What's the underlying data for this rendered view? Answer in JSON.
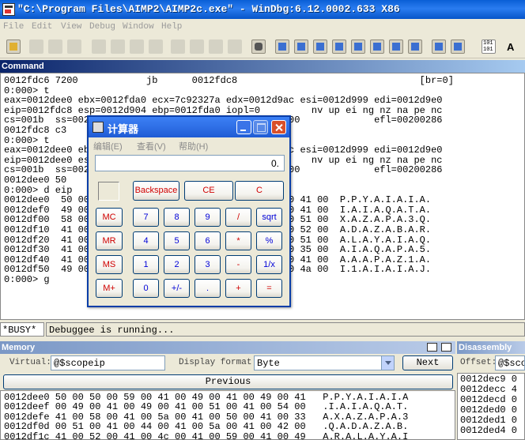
{
  "window": {
    "title": "\"C:\\Program Files\\AIMP2\\AIMP2c.exe\" - WinDbg:6.12.0002.633 X86"
  },
  "menu": [
    "File",
    "Edit",
    "View",
    "Debug",
    "Window",
    "Help"
  ],
  "toolbar": {
    "font_label": "A",
    "hex_label": "101\n101"
  },
  "command": {
    "title": "Command",
    "lines": [
      "0012fdc6 7200            jb      0012fdc8                                [br=0]",
      "0:000> t",
      "eax=0012dee0 ebx=0012fda0 ecx=7c92327a edx=0012d9ac esi=0012d999 edi=0012d9e0",
      "eip=0012fdc8 esp=0012d904 ebp=0012fda0 iopl=0         nv up ei ng nz na pe nc",
      "cs=001b  ss=0023  ds=0023  es=0023  fs=003b  gs=0000             efl=00200286",
      "0012fdc8 c3",
      "0:000> t",
      "eax=0012dee0 ebx=0012fda0 ecx=7c92327a edx=0012d9ac esi=0012d999 edi=0012d9e0",
      "eip=0012dee0 esp=0012d908 ebp=0012fda0 iopl=0         nv up ei ng nz na pe nc",
      "cs=001b  ss=0023  ds=0023  es=0023  fs=003b  gs=0000             efl=00200286",
      "0012dee0 50",
      "0:000> d eip",
      "0012dee0  50 00 50 00 59 00 41 00-49 00 41 00 49 00 41 00  P.P.Y.A.I.A.I.A.",
      "0012def0  49 00 51 00 41 00 49 00-41 00 51 00 54 00 41 00  I.A.I.A.Q.A.T.A.",
      "0012df00  58 00 41 00 5a 00 41 00-50 00 41 00 33 00 51 00  X.A.Z.A.P.A.3.Q.",
      "0012df10  41 00 44 00 41 00 5a 00-41 00 42 00 41 00 52 00  A.D.A.Z.A.B.A.R.",
      "0012df20  41 00 4c 00 41 00 59 00-41 00 49 00 41 00 51 00  A.L.A.Y.A.I.A.Q.",
      "0012df30  41 00 49 00 41 00 51 00-41 00 50 00 41 00 35 00  A.I.A.Q.A.P.A.5.",
      "0012df40  41 00 41 00 41 00 50 00-41 00 5a 00 31 00 41 00  A.A.A.P.A.Z.1.A.",
      "0012df50  49 00 31 00 41 00 49 00-41 00 49 00 41 00 4a 00  I.1.A.I.A.I.A.J.",
      "0:000> g"
    ],
    "busy_label": "*BUSY*",
    "status_text": "Debuggee is running..."
  },
  "calculator": {
    "title": "计算器",
    "menu": [
      "编辑(E)",
      "查看(V)",
      "帮助(H)"
    ],
    "display": "0.",
    "buttons": {
      "backspace": "Backspace",
      "ce": "CE",
      "c": "C",
      "mc": "MC",
      "mr": "MR",
      "ms": "MS",
      "mplus": "M+",
      "n7": "7",
      "n8": "8",
      "n9": "9",
      "div": "/",
      "sqrt": "sqrt",
      "n4": "4",
      "n5": "5",
      "n6": "6",
      "mul": "*",
      "pct": "%",
      "n1": "1",
      "n2": "2",
      "n3": "3",
      "sub": "-",
      "recip": "1/x",
      "n0": "0",
      "sign": "+/-",
      "dot": ".",
      "add": "+",
      "eq": "="
    }
  },
  "memory": {
    "title": "Memory",
    "virtual_label": "Virtual:",
    "virtual_value": "@$scopeip",
    "format_label": "Display format:",
    "format_value": "Byte",
    "next_label": "Next",
    "previous_label": "Previous",
    "lines": [
      "0012dee0 50 00 50 00 59 00 41 00 49 00 41 00 49 00 41   P.P.Y.A.I.A.I.A",
      "0012deef 00 49 00 41 00 49 00 41 00 51 00 41 00 54 00   .I.A.I.A.Q.A.T.",
      "0012defe 41 00 58 00 41 00 5a 00 41 00 50 00 41 00 33   A.X.A.Z.A.P.A.3",
      "0012df0d 00 51 00 41 00 44 00 41 00 5a 00 41 00 42 00   .Q.A.D.A.Z.A.B.",
      "0012df1c 41 00 52 00 41 00 4c 00 41 00 59 00 41 00 49   A.R.A.L.A.Y.A.I"
    ]
  },
  "disassembly": {
    "title": "Disassembly",
    "offset_label": "Offset:",
    "offset_value": "@$scop",
    "lines": [
      "0012dec9 0",
      "0012decc 4",
      "0012decd 0",
      "0012ded0 0",
      "0012ded1 0",
      "0012ded4 0"
    ]
  }
}
